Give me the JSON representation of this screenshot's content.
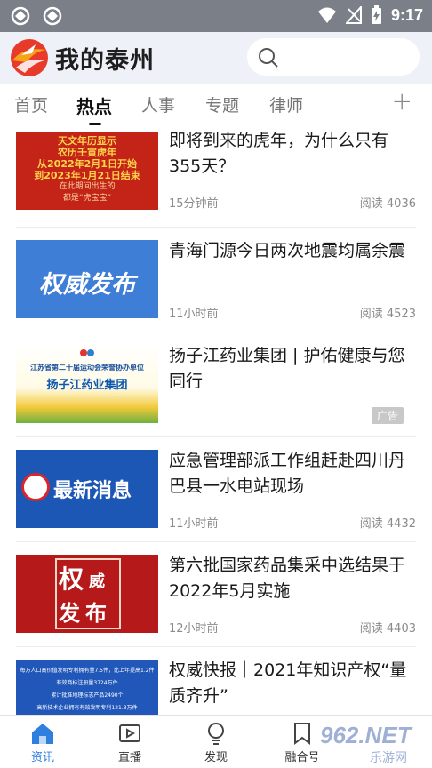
{
  "status_bar": {
    "time": "9:17"
  },
  "header": {
    "app_title": "我的泰州",
    "logo_icon": "taizhou-logo-icon",
    "search_icon": "search-icon"
  },
  "tabs": [
    {
      "label": "首页",
      "active": false
    },
    {
      "label": "热点",
      "active": true
    },
    {
      "label": "人事",
      "active": false
    },
    {
      "label": "专题",
      "active": false
    },
    {
      "label": "律师",
      "active": false
    }
  ],
  "tab_add_label": "+",
  "feed": [
    {
      "title": "即将到来的虎年，为什么只有355天？",
      "time": "15分钟前",
      "reads": "阅读 4036",
      "thumb": {
        "lines": [
          "天文年历显示",
          "农历壬寅虎年",
          "从2022年2月1日开始",
          "到2023年1月21日结束",
          "在此期间出生的",
          "都是"
        ],
        "highlight": "虎宝宝"
      }
    },
    {
      "title": "青海门源今日两次地震均属余震",
      "time": "11小时前",
      "reads": "阅读 4523",
      "thumb": {
        "text": "权威发布"
      }
    },
    {
      "title": "扬子江药业集团 | 护佑健康与您同行",
      "ad": "广告",
      "thumb": {
        "top": "江苏省第二十届运动会荣誉协办单位",
        "brand": "扬子江药业集团"
      }
    },
    {
      "title": "应急管理部派工作组赶赴四川丹巴县一水电站现场",
      "time": "11小时前",
      "reads": "阅读 4432",
      "thumb": {
        "text": "最新消息"
      }
    },
    {
      "title": "第六批国家药品集采中选结果于2022年5月实施",
      "time": "12小时前",
      "reads": "阅读 4403",
      "thumb": {
        "text": [
          "权",
          "威",
          "发",
          "布"
        ]
      }
    },
    {
      "title": "权威快报｜2021年知识产权“量质齐升”",
      "thumb": {
        "lines": [
          "每万人口高价值发明专利拥有量7.5件，比上年提高1.2件",
          "有效商标注册量3724万件",
          "累计批准地理标志产品2490个",
          "高新技术企业拥有有效发明专利121.3万件"
        ]
      }
    }
  ],
  "bottom_nav": [
    {
      "label": "资讯",
      "icon": "home-icon",
      "active": true
    },
    {
      "label": "直播",
      "icon": "play-icon",
      "active": false
    },
    {
      "label": "发现",
      "icon": "lightbulb-icon",
      "active": false
    },
    {
      "label": "融合号",
      "icon": "bookmark-icon",
      "active": false
    }
  ],
  "watermark": {
    "text": "962.NET",
    "sub": "乐游网"
  },
  "colors": {
    "accent": "#2f7fe0",
    "header_bg": "#eef1f7",
    "status_bar": "#7a7f88"
  }
}
